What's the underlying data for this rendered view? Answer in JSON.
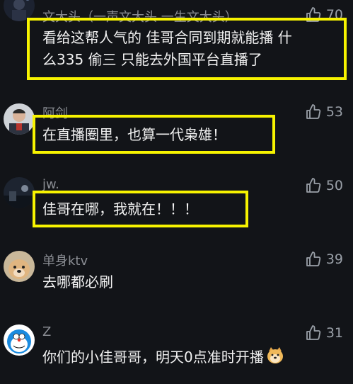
{
  "comments": [
    {
      "username": "文大头（一声文大头 一生文大头）",
      "likes": "70",
      "lines": [
        "看给这帮人气的 佳哥合同到期就能播 什",
        "么335 偷三 只能去外国平台直播了"
      ],
      "avatar": "avatar-dark-figure"
    },
    {
      "username": "阿剑",
      "likes": "53",
      "lines": [
        "在直播圈里，也算一代枭雄！"
      ],
      "avatar": "avatar-man-portrait"
    },
    {
      "username": "jw.",
      "likes": "50",
      "lines": [
        "佳哥在哪，我就在！！！"
      ],
      "avatar": "avatar-night-scene"
    },
    {
      "username": "单身ktv",
      "likes": "39",
      "lines": [
        "去哪都必刷"
      ],
      "avatar": "avatar-dog"
    },
    {
      "username": "Z",
      "likes": "31",
      "lines": [
        "你们的小佳哥哥，明天0点准时开播"
      ],
      "avatar": "avatar-doraemon",
      "trailing_emoji": "doge-emoji"
    }
  ],
  "colors": {
    "background": "#121418",
    "highlight": "#f7f300",
    "username": "#8a8d93",
    "text": "#f2f2f2"
  }
}
